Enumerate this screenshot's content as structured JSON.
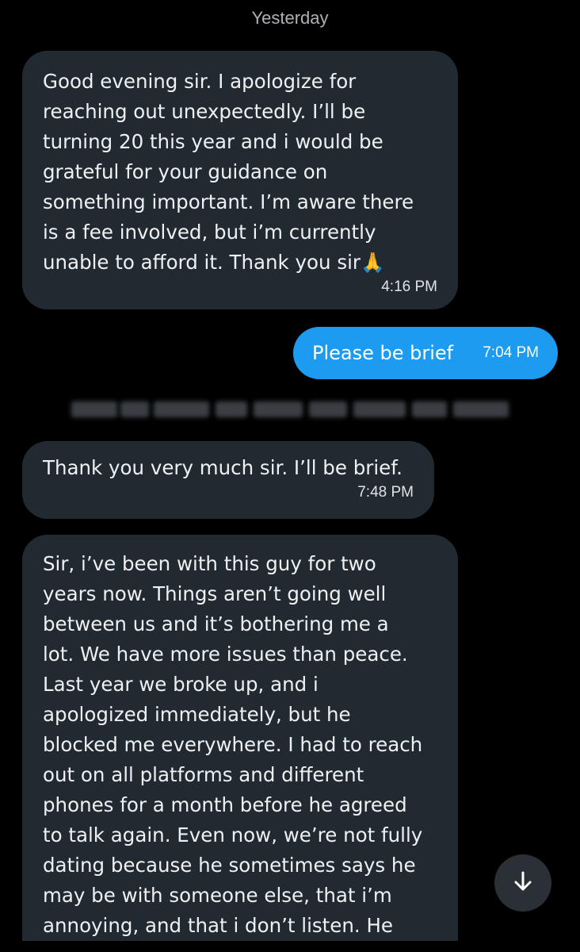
{
  "date_separator": "Yesterday",
  "messages": {
    "m1": {
      "text": "Good evening sir. I apologize for\nreaching out unexpectedly. I’ll be\nturning 20 this year and i would be\ngrateful for your guidance on\nsomething important. I’m aware there\nis a fee involved, but i’m currently\nunable to afford it. Thank you sir🙏",
      "time": "4:16 PM"
    },
    "m2": {
      "text": "Please be brief",
      "time": "7:04 PM"
    },
    "m3": {
      "text": "Thank you very much sir. I’ll be brief.",
      "time": "7:48 PM"
    },
    "m4": {
      "text": "Sir, i’ve been with this guy for two\nyears now. Things aren’t going well\nbetween us and it’s bothering me a\nlot. We have more issues than peace.\nLast year we broke up, and i\napologized immediately, but he\nblocked me everywhere. I had to reach\nout on all platforms and different\nphones for a month before he agreed\nto talk again. Even now, we’re not fully\ndating because he sometimes says he\nmay be with someone else, that i’m\nannoying, and that i don’t listen. He"
    }
  },
  "colors": {
    "background": "#000000",
    "received_bubble": "#222a31",
    "sent_bubble": "#1d9bf0"
  },
  "icons": {
    "scroll_down": "arrow-down-icon"
  }
}
